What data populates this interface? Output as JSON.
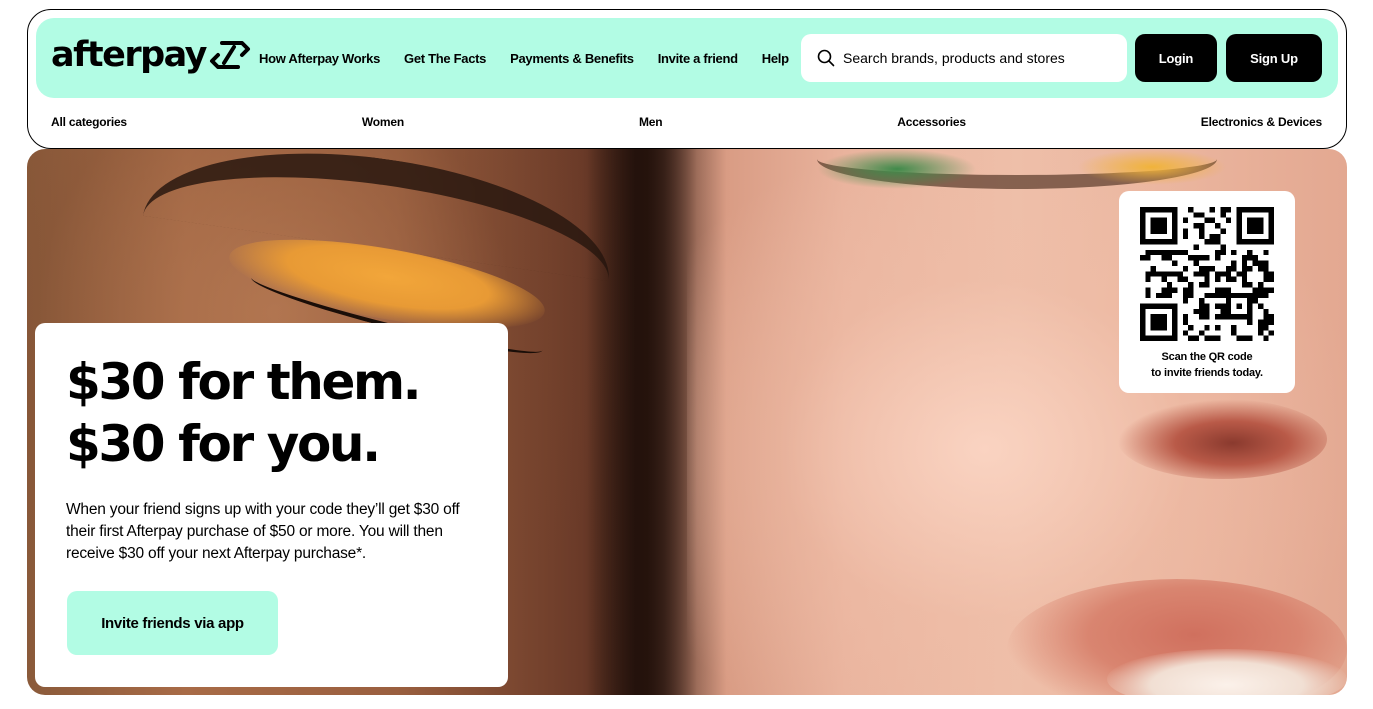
{
  "brand": {
    "logo_text": "afterpay",
    "accent_color": "#b2fce4"
  },
  "nav": {
    "links": [
      "How Afterpay Works",
      "Get The Facts",
      "Payments & Benefits",
      "Invite a friend",
      "Help"
    ]
  },
  "search": {
    "placeholder": "Search brands, products and stores",
    "icon": "search-icon"
  },
  "auth": {
    "login_label": "Login",
    "signup_label": "Sign Up"
  },
  "categories": [
    "All categories",
    "Women",
    "Men",
    "Accessories",
    "Electronics & Devices"
  ],
  "hero": {
    "headline_line1": "$30 for them.",
    "headline_line2": "$30 for you.",
    "body": "When your friend signs up with your code they’ll get $30 off their first Afterpay purchase of $50 or more. You will then receive $30 off your next Afterpay purchase*.",
    "cta_label": "Invite friends via app"
  },
  "qr": {
    "caption_line1": "Scan the QR code",
    "caption_line2": "to invite friends today."
  }
}
